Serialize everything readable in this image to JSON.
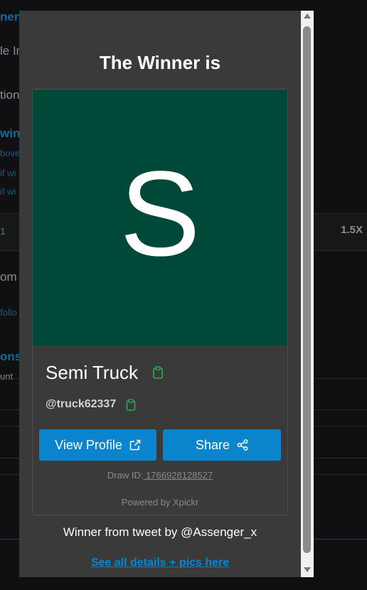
{
  "background": {
    "fragments": [
      "nen",
      "le In",
      "tion",
      "win",
      "bove",
      "if wi",
      "if wi",
      "1",
      "1.5X",
      "om I",
      "follo",
      "ons",
      "unt"
    ]
  },
  "modal": {
    "title": "The Winner is",
    "avatar": {
      "letter": "S",
      "bg_color": "#004939"
    },
    "name": "Semi Truck",
    "handle": "@truck62337",
    "view_profile_label": "View Profile",
    "share_label": "Share",
    "draw_id_label": "Draw ID:",
    "draw_id_value": " 1766928128527",
    "powered_by": "Powered by Xpickr",
    "tweet_text": "Winner from tweet by @Assenger_x",
    "details_link": "See all details + pics here",
    "icons": {
      "copy_name": "clipboard-icon",
      "copy_handle": "clipboard-icon",
      "view_profile": "external-link-icon",
      "share": "share-icon"
    }
  },
  "colors": {
    "accent": "#0a84cc",
    "clipboard": "#2fae5a",
    "modal_bg": "#3b3a3a"
  }
}
